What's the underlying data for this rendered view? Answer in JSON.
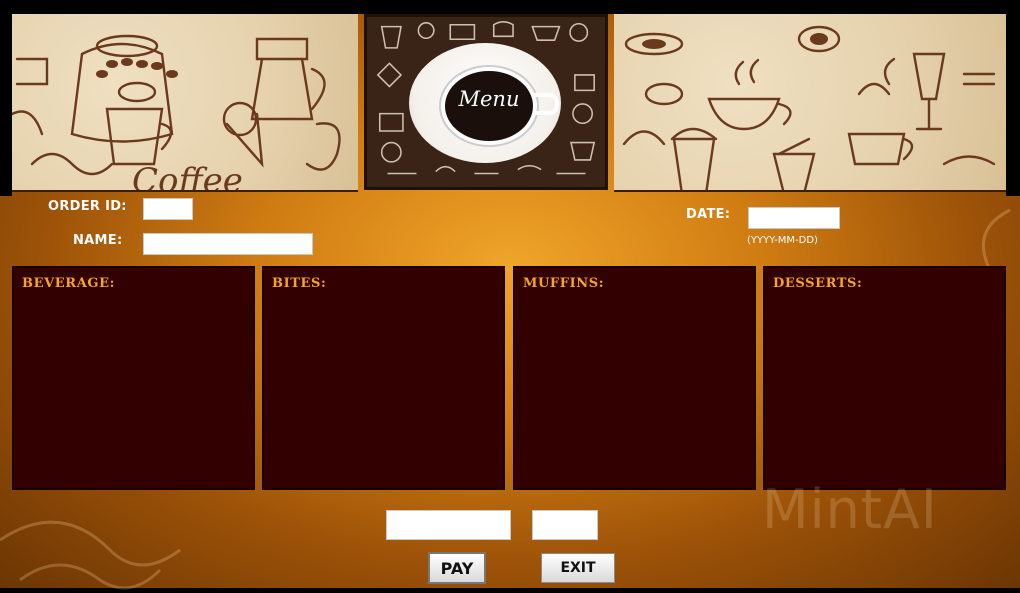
{
  "banner": {
    "menu_label": "Menu"
  },
  "form": {
    "order_id_label": "ORDER ID:",
    "order_id_value": "",
    "name_label": "NAME:",
    "name_value": "",
    "date_label": "DATE:",
    "date_value": "",
    "date_hint": "(YYYY-MM-DD)"
  },
  "categories": [
    {
      "title": "BEVERAGE:"
    },
    {
      "title": "BITES:"
    },
    {
      "title": "MUFFINS:"
    },
    {
      "title": "DESSERTS:"
    }
  ],
  "footer": {
    "total_value": "",
    "qty_value": "",
    "pay_label": "PAY",
    "exit_label": "EXIT"
  },
  "watermark": "MintAI",
  "colors": {
    "panel_bg": "#330000",
    "category_title": "#f5a524",
    "background_gold": "#e0901a"
  }
}
